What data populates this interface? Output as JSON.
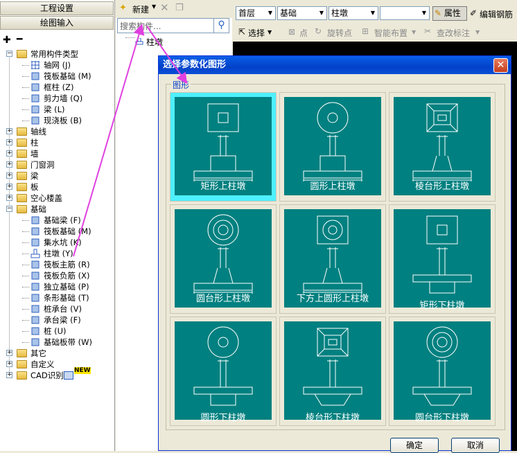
{
  "left_panel": {
    "btn_settings": "工程设置",
    "btn_draw_input": "绘图输入",
    "tree": [
      {
        "label": "常用构件类型",
        "type": "folder",
        "expanded": true,
        "level": 0
      },
      {
        "label": "轴网 (J)",
        "level": 1,
        "icon": "grid-icon"
      },
      {
        "label": "筏板基础 (M)",
        "level": 1,
        "icon": "raft-icon"
      },
      {
        "label": "框柱 (Z)",
        "level": 1,
        "icon": "column-icon"
      },
      {
        "label": "剪力墙 (Q)",
        "level": 1,
        "icon": "wall-icon"
      },
      {
        "label": "梁 (L)",
        "level": 1,
        "icon": "beam-icon"
      },
      {
        "label": "现浇板 (B)",
        "level": 1,
        "icon": "slab-icon"
      },
      {
        "label": "轴线",
        "type": "folder",
        "level": 0
      },
      {
        "label": "柱",
        "type": "folder",
        "level": 0
      },
      {
        "label": "墙",
        "type": "folder",
        "level": 0
      },
      {
        "label": "门窗洞",
        "type": "folder",
        "level": 0
      },
      {
        "label": "梁",
        "type": "folder",
        "level": 0
      },
      {
        "label": "板",
        "type": "folder",
        "level": 0
      },
      {
        "label": "空心楼盖",
        "type": "folder",
        "level": 0
      },
      {
        "label": "基础",
        "type": "folder",
        "expanded": true,
        "level": 0
      },
      {
        "label": "基础梁 (F)",
        "level": 1,
        "icon": "foundation-beam-icon"
      },
      {
        "label": "筏板基础 (M)",
        "level": 1,
        "icon": "raft-icon"
      },
      {
        "label": "集水坑 (K)",
        "level": 1,
        "icon": "sump-icon"
      },
      {
        "label": "柱墩 (Y)",
        "level": 1,
        "icon": "pier-icon"
      },
      {
        "label": "筏板主筋 (R)",
        "level": 1,
        "icon": "rebar-icon"
      },
      {
        "label": "筏板负筋 (X)",
        "level": 1,
        "icon": "rebar-icon"
      },
      {
        "label": "独立基础 (P)",
        "level": 1,
        "icon": "isolated-footing-icon"
      },
      {
        "label": "条形基础 (T)",
        "level": 1,
        "icon": "strip-footing-icon"
      },
      {
        "label": "桩承台 (V)",
        "level": 1,
        "icon": "pile-cap-icon"
      },
      {
        "label": "承台梁 (F)",
        "level": 1,
        "icon": "cap-beam-icon"
      },
      {
        "label": "桩 (U)",
        "level": 1,
        "icon": "pile-icon"
      },
      {
        "label": "基础板带 (W)",
        "level": 1,
        "icon": "strip-icon"
      },
      {
        "label": "其它",
        "type": "folder",
        "level": 0
      },
      {
        "label": "自定义",
        "type": "folder",
        "level": 0
      },
      {
        "label": "CAD识别",
        "type": "folder",
        "level": 0,
        "badge": "NEW"
      }
    ]
  },
  "middle_panel": {
    "new_button": "新建",
    "search_placeholder": "搜索构件...",
    "tree_item": "柱墩"
  },
  "toolbar": {
    "floor": "首层",
    "category": "基础",
    "component": "柱墩",
    "properties": "属性",
    "edit_rebar": "编辑钢筋",
    "select": "选择",
    "point": "点",
    "rotate_point": "旋转点",
    "smart_layout": "智能布置",
    "check_annotation": "查改标注"
  },
  "dialog": {
    "title": "选择参数化图形",
    "group_label": "图形",
    "shapes": [
      {
        "label": "矩形上柱墩",
        "selected": true
      },
      {
        "label": "圆形上柱墩"
      },
      {
        "label": "棱台形上柱墩"
      },
      {
        "label": "圆台形上柱墩"
      },
      {
        "label": "下方上圆形上柱墩"
      },
      {
        "label": "矩形下柱墩"
      },
      {
        "label": "圆形下柱墩"
      },
      {
        "label": "棱台形下柱墩"
      },
      {
        "label": "圆台形下柱墩"
      }
    ],
    "ok": "确定",
    "cancel": "取消"
  },
  "colors": {
    "tile": "#008080",
    "selected": "#4ef0ff",
    "annotation_arrow": "#e040e0",
    "dialog_title": "#0a5fe8"
  }
}
